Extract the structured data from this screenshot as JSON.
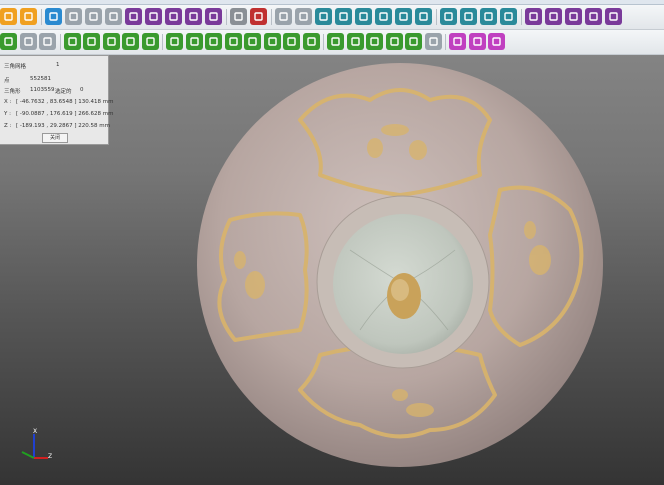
{
  "panel": {
    "title": "三角网格",
    "title_value": "1",
    "points_label": "点",
    "points_value": "552581",
    "triangles_label": "三角形",
    "triangles_value": "1103559",
    "selected_label": "选定的",
    "selected_value": "0",
    "x_label": "X :",
    "x_value": "[ -46.7632 , 83.6548 ]  130.418 mm",
    "y_label": "Y :",
    "y_value": "[ -90.0887 , 176.619 ]  266.628 mm",
    "z_label": "Z :",
    "z_value": "[ -189.193 , 29.2867 ]  220.58 mm",
    "close_label": "关闭"
  },
  "axis": {
    "x_label": "X",
    "z_label": "Z"
  },
  "colors": {
    "green_tool": "#3a9a2e",
    "purple_tool": "#7a3a9a",
    "teal_tool": "#2a8a9a",
    "gray_tool": "#9aa3ab",
    "orange_tool": "#f0a020",
    "bowl_glaze": "#b9a9a4",
    "gold_decor": "#d9b46a"
  },
  "toolbar1": [
    {
      "name": "open-icon",
      "color": "#f0a020"
    },
    {
      "name": "power-icon",
      "color": "#f0a020"
    },
    {
      "name": "select-brush-icon",
      "color": "#2a8ad0"
    },
    {
      "name": "tool-2-icon",
      "color": "#9aa3ab"
    },
    {
      "name": "tool-3-icon",
      "color": "#9aa3ab"
    },
    {
      "name": "tool-4-icon",
      "color": "#9aa3ab"
    },
    {
      "name": "tool-5-icon",
      "color": "#7a3a9a"
    },
    {
      "name": "tool-6-icon",
      "color": "#7a3a9a"
    },
    {
      "name": "tool-7-icon",
      "color": "#7a3a9a"
    },
    {
      "name": "tool-8-icon",
      "color": "#7a3a9a"
    },
    {
      "name": "pencil-icon",
      "color": "#7a3a9a"
    },
    {
      "name": "scanner-icon",
      "color": "#8a8f95"
    },
    {
      "name": "atom-icon",
      "color": "#c03030"
    },
    {
      "name": "tool-12-icon",
      "color": "#9aa3ab"
    },
    {
      "name": "tool-13-icon",
      "color": "#9aa3ab"
    },
    {
      "name": "rectangle-select-icon",
      "color": "#2a8a9a"
    },
    {
      "name": "ellipse-select-icon",
      "color": "#2a8a9a"
    },
    {
      "name": "tool-16-icon",
      "color": "#2a8a9a"
    },
    {
      "name": "tool-17-icon",
      "color": "#2a8a9a"
    },
    {
      "name": "tool-18-icon",
      "color": "#2a8a9a"
    },
    {
      "name": "line-select-icon",
      "color": "#2a8a9a"
    },
    {
      "name": "cube-icon",
      "color": "#2a8a9a"
    },
    {
      "name": "tool-21-icon",
      "color": "#2a8a9a"
    },
    {
      "name": "tool-22-icon",
      "color": "#2a8a9a"
    },
    {
      "name": "tool-23-icon",
      "color": "#2a8a9a"
    },
    {
      "name": "window-icon",
      "color": "#7a3a9a"
    },
    {
      "name": "tool-25-icon",
      "color": "#7a3a9a"
    },
    {
      "name": "tool-26-icon",
      "color": "#7a3a9a"
    },
    {
      "name": "zoom-icon",
      "color": "#7a3a9a"
    },
    {
      "name": "tool-28-icon",
      "color": "#7a3a9a"
    }
  ],
  "toolbar2": [
    {
      "name": "tool-b0-icon",
      "color": "#3a9a2e"
    },
    {
      "name": "tool-b1-icon",
      "color": "#9aa3ab"
    },
    {
      "name": "tool-b2-icon",
      "color": "#9aa3ab"
    },
    {
      "name": "tool-b3-icon",
      "color": "#3a9a2e"
    },
    {
      "name": "tool-b4-icon",
      "color": "#3a9a2e"
    },
    {
      "name": "tool-b5-icon",
      "color": "#3a9a2e"
    },
    {
      "name": "tool-b6-icon",
      "color": "#3a9a2e"
    },
    {
      "name": "tool-b7-icon",
      "color": "#3a9a2e"
    },
    {
      "name": "tool-b8-icon",
      "color": "#3a9a2e"
    },
    {
      "name": "tool-b9-icon",
      "color": "#3a9a2e"
    },
    {
      "name": "tool-b10-icon",
      "color": "#3a9a2e"
    },
    {
      "name": "tool-b11-icon",
      "color": "#3a9a2e"
    },
    {
      "name": "tool-b12-icon",
      "color": "#3a9a2e"
    },
    {
      "name": "tool-b13-icon",
      "color": "#3a9a2e"
    },
    {
      "name": "tool-b14-icon",
      "color": "#3a9a2e"
    },
    {
      "name": "tool-b15-icon",
      "color": "#3a9a2e"
    },
    {
      "name": "tool-b16-icon",
      "color": "#3a9a2e"
    },
    {
      "name": "tool-b17-icon",
      "color": "#3a9a2e"
    },
    {
      "name": "tool-b18-icon",
      "color": "#3a9a2e"
    },
    {
      "name": "tool-b19-icon",
      "color": "#3a9a2e"
    },
    {
      "name": "tool-b20-icon",
      "color": "#3a9a2e"
    },
    {
      "name": "tool-b21-icon",
      "color": "#9aa3ab"
    },
    {
      "name": "lightbulb-icon",
      "color": "#c040c0"
    },
    {
      "name": "tool-b23-icon",
      "color": "#c040c0"
    },
    {
      "name": "tool-b24-icon",
      "color": "#c040c0"
    }
  ]
}
